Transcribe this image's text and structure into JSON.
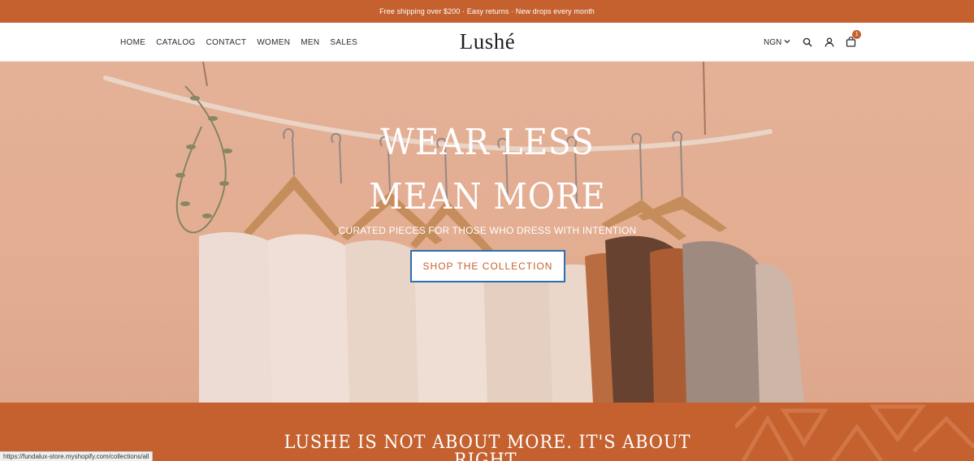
{
  "announcement": "Free shipping over $200 · Easy returns · New drops every month",
  "nav": {
    "items": [
      "HOME",
      "CATALOG",
      "CONTACT",
      "WOMEN",
      "MEN",
      "SALES"
    ]
  },
  "logo": "Lushé",
  "header_tools": {
    "currency": "NGN",
    "search_icon": "search-icon",
    "account_icon": "user-icon",
    "cart_icon": "bag-icon",
    "cart_count": "1"
  },
  "hero": {
    "headline_line1": "WEAR LESS",
    "headline_line2": "MEAN MORE",
    "subheading": "CURATED PIECES FOR THOSE WHO DRESS WITH INTENTION",
    "cta_label": "SHOP THE COLLECTION"
  },
  "band": {
    "text": "LUSHE IS NOT ABOUT MORE. IT'S ABOUT RIGHT."
  },
  "status_bar": {
    "url": "https://fundalux-store.myshopify.com/collections/all"
  },
  "colors": {
    "accent": "#c4612f",
    "cta_border": "#2a6fb0",
    "hero_tint": "#e9bba2"
  }
}
